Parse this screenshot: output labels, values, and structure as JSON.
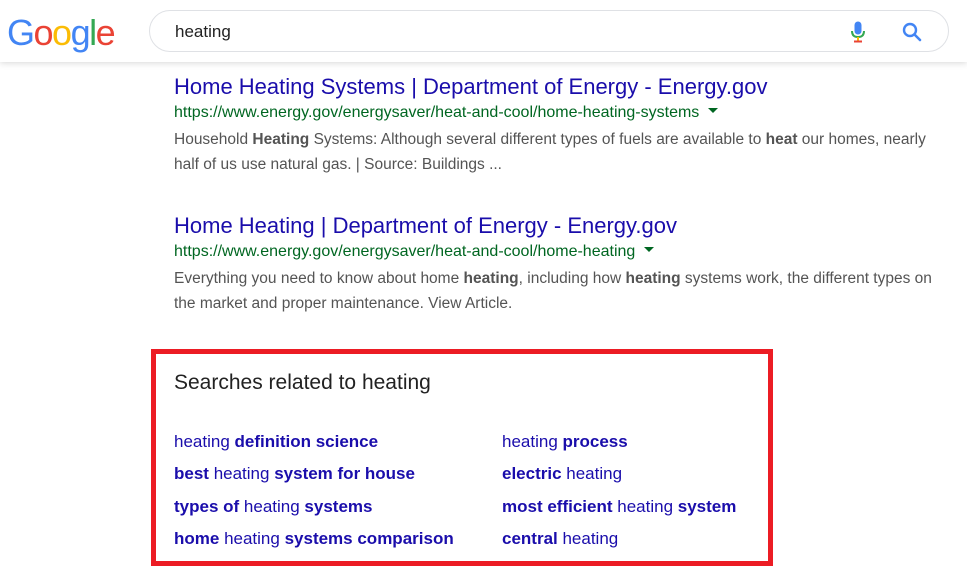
{
  "search": {
    "query": "heating"
  },
  "logo": {
    "letters": [
      "G",
      "o",
      "o",
      "g",
      "l",
      "e"
    ],
    "colors": [
      "#4285f4",
      "#ea4335",
      "#fbbc05",
      "#4285f4",
      "#34a853",
      "#ea4335"
    ]
  },
  "results": [
    {
      "title": "Home Heating Systems | Department of Energy - Energy.gov",
      "url": "https://www.energy.gov/energysaver/heat-and-cool/home-heating-systems",
      "snippet": [
        {
          "text": "Household ",
          "bold": false
        },
        {
          "text": "Heating",
          "bold": true
        },
        {
          "text": " Systems: Although several different types of fuels are available to ",
          "bold": false
        },
        {
          "text": "heat",
          "bold": true
        },
        {
          "text": " our homes, nearly half of us use natural gas. | Source: Buildings ...",
          "bold": false
        }
      ]
    },
    {
      "title": "Home Heating | Department of Energy - Energy.gov",
      "url": "https://www.energy.gov/energysaver/heat-and-cool/home-heating",
      "snippet": [
        {
          "text": "Everything you need to know about home ",
          "bold": false
        },
        {
          "text": "heating",
          "bold": true
        },
        {
          "text": ", including how ",
          "bold": false
        },
        {
          "text": "heating",
          "bold": true
        },
        {
          "text": " systems work, the different types on the market and proper maintenance. View Article.",
          "bold": false
        }
      ]
    }
  ],
  "related": {
    "title": "Searches related to heating",
    "items": [
      [
        {
          "text": "heating ",
          "bold": false
        },
        {
          "text": "definition science",
          "bold": true
        }
      ],
      [
        {
          "text": "heating ",
          "bold": false
        },
        {
          "text": "process",
          "bold": true
        }
      ],
      [
        {
          "text": "best",
          "bold": true
        },
        {
          "text": " heating ",
          "bold": false
        },
        {
          "text": "system for house",
          "bold": true
        }
      ],
      [
        {
          "text": "electric",
          "bold": true
        },
        {
          "text": " heating",
          "bold": false
        }
      ],
      [
        {
          "text": "types of",
          "bold": true
        },
        {
          "text": " heating ",
          "bold": false
        },
        {
          "text": "systems",
          "bold": true
        }
      ],
      [
        {
          "text": "most efficient",
          "bold": true
        },
        {
          "text": " heating ",
          "bold": false
        },
        {
          "text": "system",
          "bold": true
        }
      ],
      [
        {
          "text": "home",
          "bold": true
        },
        {
          "text": " heating ",
          "bold": false
        },
        {
          "text": "systems comparison",
          "bold": true
        }
      ],
      [
        {
          "text": "central",
          "bold": true
        },
        {
          "text": " heating",
          "bold": false
        }
      ]
    ]
  },
  "icons": {
    "mic": "microphone-icon",
    "search": "search-icon"
  },
  "colors": {
    "link": "#1a0dab",
    "url": "#006621",
    "snippet": "#545454",
    "highlight_border": "#ec1c24"
  }
}
